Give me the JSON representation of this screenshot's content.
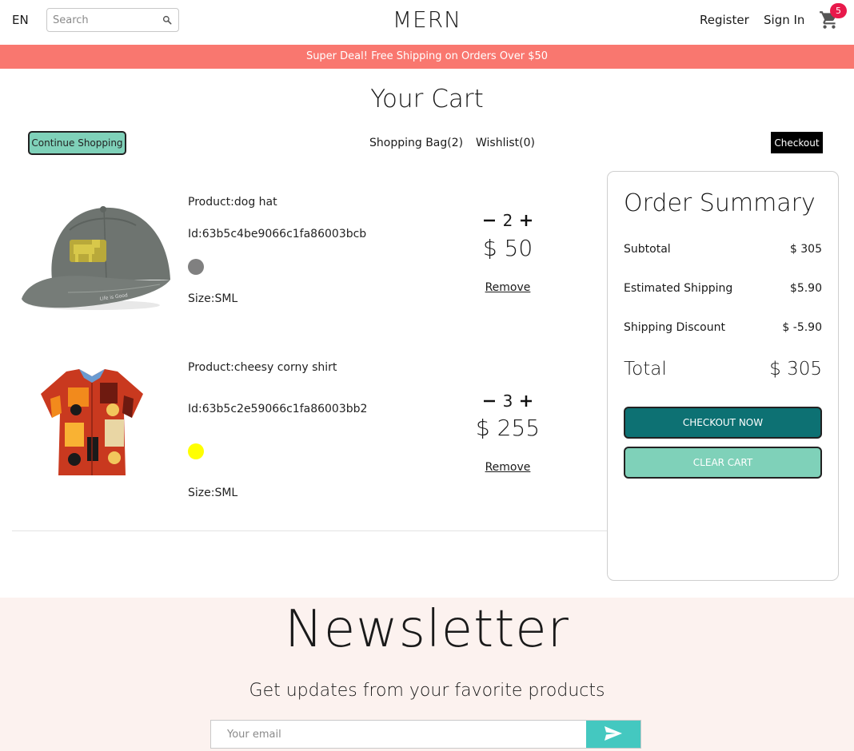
{
  "nav": {
    "lang": "EN",
    "search_placeholder": "Search",
    "logo": "MERN",
    "register": "Register",
    "sign_in": "Sign In",
    "cart_count": "5"
  },
  "announcement": "Super Deal! Free Shipping on Orders Over $50",
  "page_title": "Your Cart",
  "top": {
    "continue": "Continue Shopping",
    "bag": "Shopping Bag(2)",
    "wishlist": "Wishlist(0)",
    "checkout": "Checkout"
  },
  "products": [
    {
      "name": "Product:dog hat",
      "id": "Id:63b5c4be9066c1fa86003bcb",
      "color": "#808080",
      "size": "Size:SML",
      "qty": "2",
      "price": "$ 50",
      "remove": "Remove"
    },
    {
      "name": "Product:cheesy corny shirt",
      "id": "Id:63b5c2e59066c1fa86003bb2",
      "color": "#ffff00",
      "size": "Size:SML",
      "qty": "3",
      "price": "$ 255",
      "remove": "Remove"
    }
  ],
  "summary": {
    "title": "Order Summary",
    "subtotal_label": "Subtotal",
    "subtotal": "$ 305",
    "shipping_label": "Estimated Shipping",
    "shipping": "$5.90",
    "discount_label": "Shipping Discount",
    "discount": "$ -5.90",
    "total_label": "Total",
    "total": "$ 305",
    "checkout_now": "CHECKOUT NOW",
    "clear_cart": "CLEAR CART"
  },
  "newsletter": {
    "title": "Newsletter",
    "subtitle": "Get updates from your favorite products",
    "placeholder": "Your email"
  },
  "colors": {
    "announcement_bg": "#f9776f",
    "accent_mint": "#7fd1b9",
    "accent_teal": "#0d7173",
    "send_button": "#44c8c0",
    "badge": "#e8194b",
    "newsletter_bg": "#fcf2ef"
  }
}
